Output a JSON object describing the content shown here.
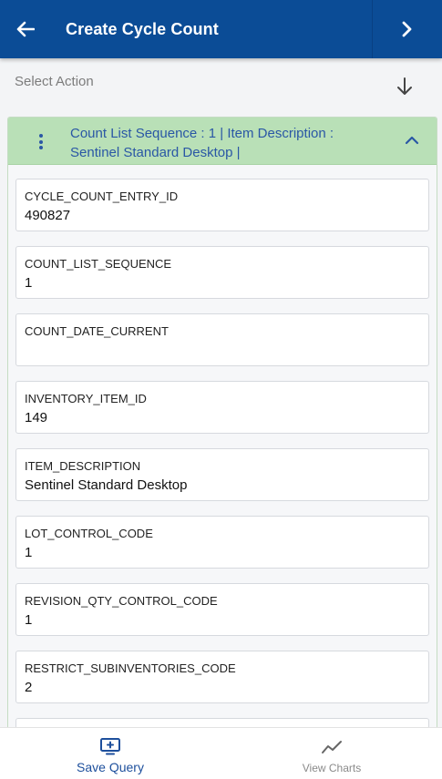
{
  "header": {
    "title": "Create Cycle Count"
  },
  "action_bar": {
    "label": "Select Action"
  },
  "panel": {
    "title_line1": "Count List Sequence : 1 | Item Description :",
    "title_line2": "Sentinel Standard Desktop |"
  },
  "fields": [
    {
      "label": "CYCLE_COUNT_ENTRY_ID",
      "value": "490827"
    },
    {
      "label": "COUNT_LIST_SEQUENCE",
      "value": "1"
    },
    {
      "label": "COUNT_DATE_CURRENT",
      "value": ""
    },
    {
      "label": "INVENTORY_ITEM_ID",
      "value": "149"
    },
    {
      "label": "ITEM_DESCRIPTION",
      "value": "Sentinel Standard Desktop"
    },
    {
      "label": "LOT_CONTROL_CODE",
      "value": "1"
    },
    {
      "label": "REVISION_QTY_CONTROL_CODE",
      "value": "1"
    },
    {
      "label": "RESTRICT_SUBINVENTORIES_CODE",
      "value": "2"
    }
  ],
  "bottom_nav": {
    "save_label": "Save Query",
    "charts_label": "View Charts"
  },
  "colors": {
    "header_bg": "#0b4c96",
    "panel_header_bg": "#b9e0b7",
    "panel_title": "#2a57a5",
    "save_accent": "#1d4f9c"
  },
  "icons": {
    "back": "arrow-left-icon",
    "next": "chevron-right-icon",
    "action": "arrow-down-icon",
    "kebab": "kebab-menu-icon",
    "collapse": "chevron-up-icon",
    "save": "monitor-plus-icon",
    "charts": "line-chart-icon"
  }
}
